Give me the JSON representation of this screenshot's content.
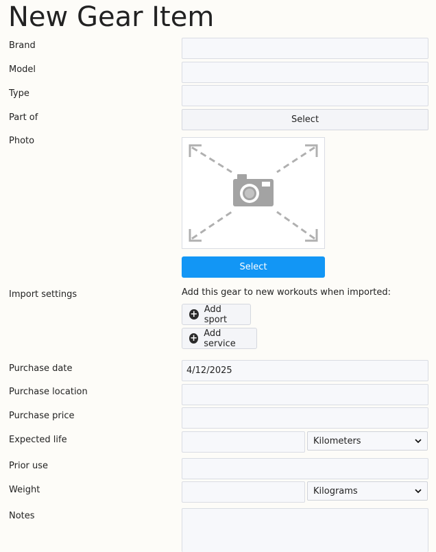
{
  "page": {
    "title": "New Gear Item"
  },
  "fields": {
    "brand": {
      "label": "Brand",
      "value": ""
    },
    "model": {
      "label": "Model",
      "value": ""
    },
    "type": {
      "label": "Type",
      "value": ""
    },
    "part_of": {
      "label": "Part of",
      "button": "Select"
    },
    "photo": {
      "label": "Photo",
      "button": "Select",
      "icon": "camera-placeholder-icon"
    },
    "import_settings": {
      "label": "Import settings",
      "help": "Add this gear to new workouts when imported:",
      "add_sport": "Add sport",
      "add_service": "Add service"
    },
    "purchase_date": {
      "label": "Purchase date",
      "value": "4/12/2025"
    },
    "purchase_location": {
      "label": "Purchase location",
      "value": ""
    },
    "purchase_price": {
      "label": "Purchase price",
      "value": ""
    },
    "expected_life": {
      "label": "Expected life",
      "value": "",
      "unit": "Kilometers"
    },
    "prior_use": {
      "label": "Prior use",
      "value": ""
    },
    "weight": {
      "label": "Weight",
      "value": "",
      "unit": "Kilograms"
    },
    "notes": {
      "label": "Notes",
      "value": ""
    }
  },
  "colors": {
    "primary": "#1296f5",
    "background": "#fdfcf8"
  }
}
